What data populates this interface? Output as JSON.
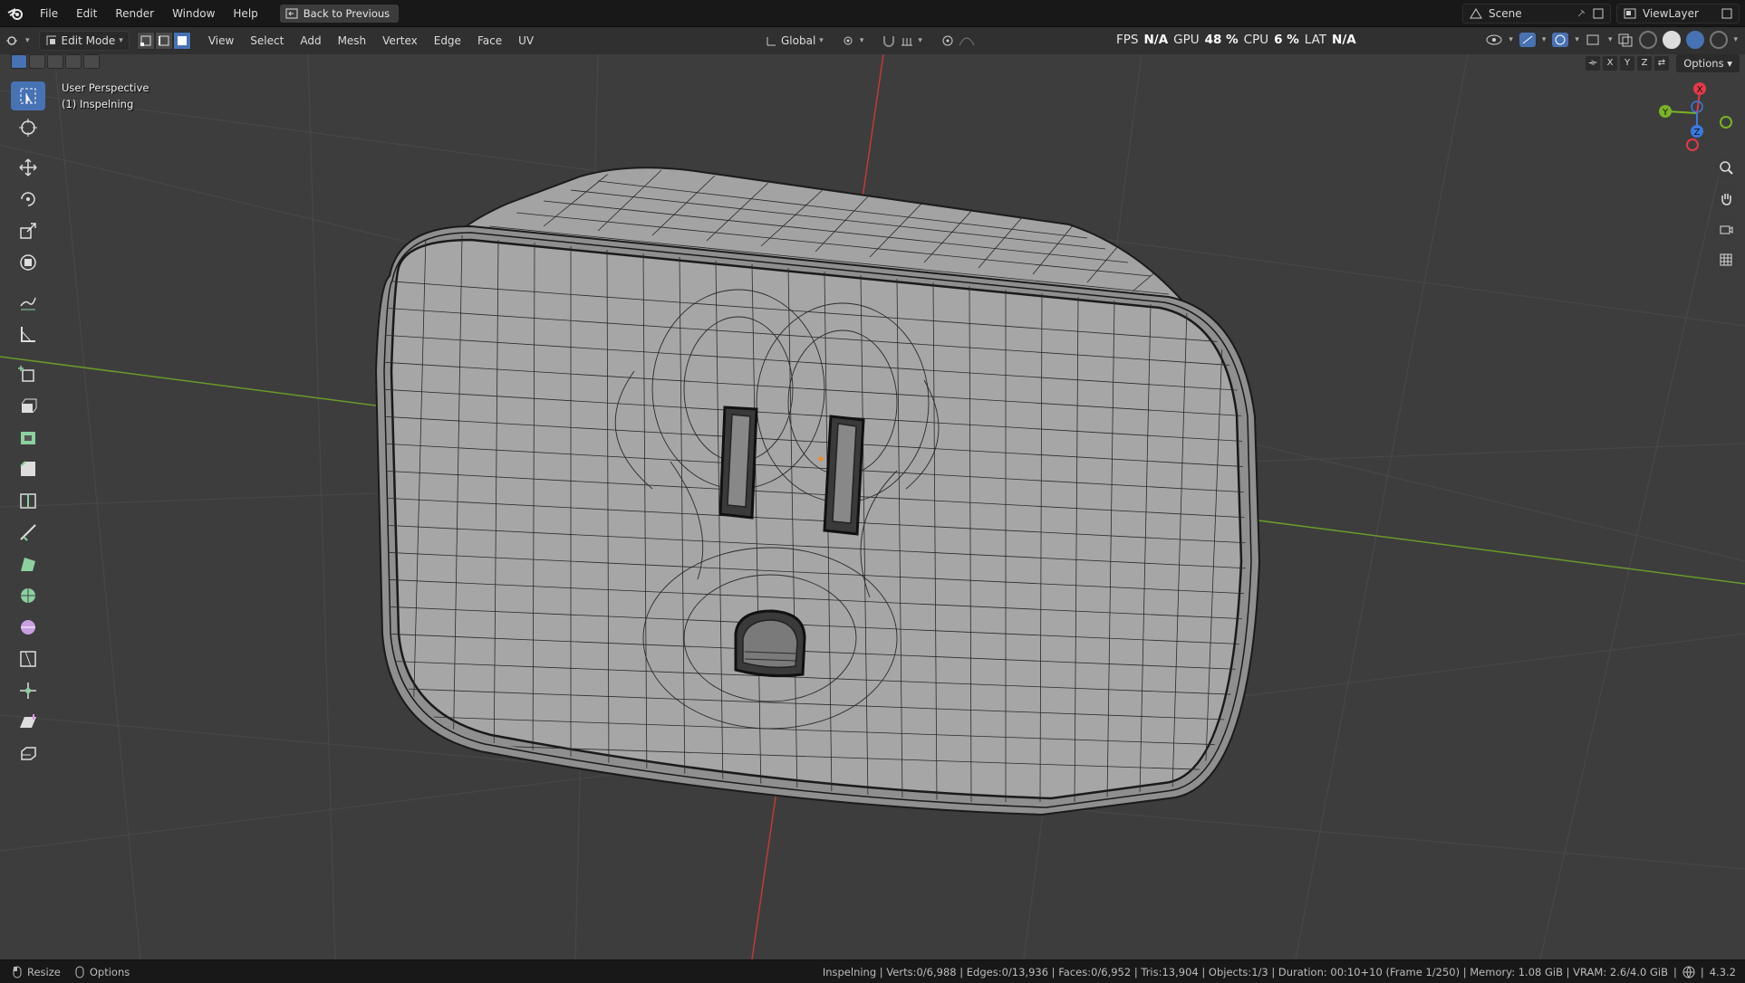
{
  "topbar": {
    "menus": [
      "File",
      "Edit",
      "Render",
      "Window",
      "Help"
    ],
    "back_button": "Back to Previous",
    "scene_name": "Scene",
    "view_layer": "ViewLayer"
  },
  "header": {
    "mode": "Edit Mode",
    "menus": [
      "View",
      "Select",
      "Add",
      "Mesh",
      "Vertex",
      "Edge",
      "Face",
      "UV"
    ],
    "transform_orientation": "Global",
    "options_label": "Options",
    "axis_labels": [
      "X",
      "Y",
      "Z"
    ]
  },
  "perf": {
    "fps_label": "FPS",
    "fps_value": "N/A",
    "gpu_label": "GPU",
    "gpu_value": "48 %",
    "cpu_label": "CPU",
    "cpu_value": "6 %",
    "lat_label": "LAT",
    "lat_value": "N/A"
  },
  "viewport": {
    "view_name": "User Perspective",
    "object_info": "(1) Inspelning"
  },
  "gizmo": {
    "x": "X",
    "y": "Y",
    "z": "Z"
  },
  "statusbar": {
    "left": [
      "Resize",
      "Options"
    ],
    "stats": "Inspelning | Verts:0/6,988 | Edges:0/13,936 | Faces:0/6,952 | Tris:13,904 | Objects:1/3 | Duration: 00:10+10 (Frame 1/250) | Memory: 1.08 GiB | VRAM: 2.6/4.0 GiB",
    "version": "4.3.2"
  },
  "colors": {
    "accent": "#4772b3",
    "viewport_bg": "#3d3d3d",
    "x_axis": "#c23a3a",
    "y_axis": "#6a9a2a",
    "mesh_face": "#a6a6a6",
    "wire": "#1c1c1c"
  }
}
